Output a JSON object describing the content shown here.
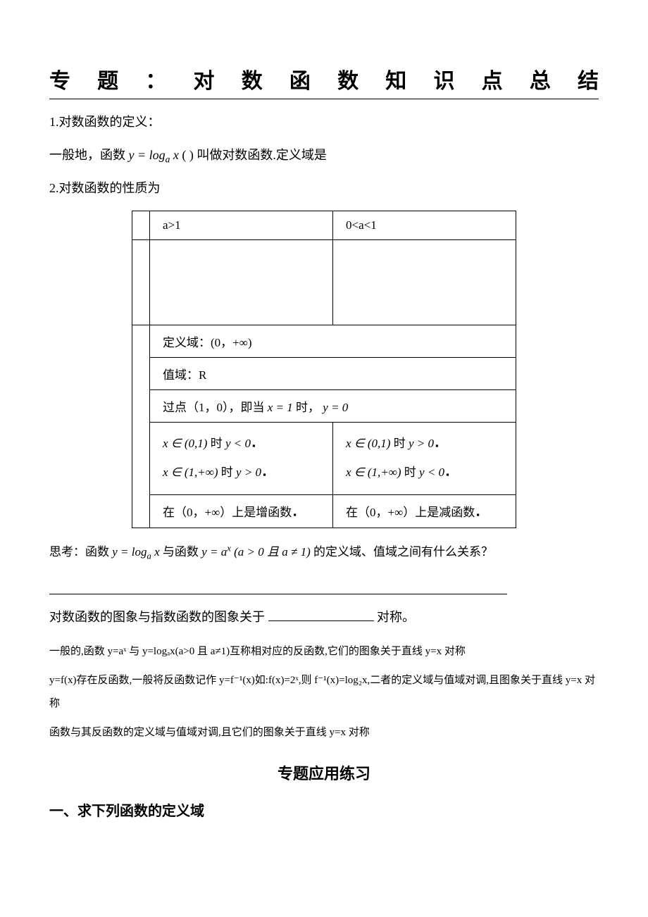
{
  "title": "专题：对数函数知识点总结",
  "p1_lead": "1.对数函数的定义：",
  "p1_body_a": "一般地，函数 ",
  "p1_body_b": " ( ) 叫做对数函数.定义域是",
  "p2_lead": "2.对数函数的性质为",
  "table": {
    "h1": "a>1",
    "h2": "0<a<1",
    "domain": "定义域：(0，+∞)",
    "range": "值域：R",
    "point_a": "过点（1，0），即当 ",
    "point_b": " 时，",
    "l1": " 时 ",
    "r1": " 时 ",
    "l2": " 时 ",
    "r2": " 时 ",
    "inc": "在（0，+∞）上是增函数",
    "dec": "在（0，+∞）上是减函数"
  },
  "think_a": "思考：函数 ",
  "think_b": " 与函数 ",
  "think_c": " 的定义域、值域之间有什么关系？",
  "sym_line_a": "对数函数的图象与指数函数的图象关于",
  "sym_line_b": "对称。",
  "sp1": "一般的,函数 y=aˣ 与 y=logₐx(a>0 且 a≠1)互称相对应的反函数,它们的图象关于直线 y=x 对称",
  "sp2": "y=f(x)存在反函数,一般将反函数记作 y=f⁻¹(x)如:f(x)=2ˣ,则 f⁻¹(x)=log₂x,二者的定义域与值域对调,且图象关于直线 y=x 对称",
  "sp3": "函数与其反函数的定义域与值域对调,且它们的图象关于直线 y=x 对称",
  "subheading": "专题应用练习",
  "section1": "一、求下列函数的定义域",
  "math": {
    "ylogax": "y = logₐ x",
    "x_eq_1": "x = 1",
    "y_eq_0": "y = 0",
    "x01": "x ∈ (0,1)",
    "ylt0": "y < 0",
    "ygt0": "y > 0",
    "x1inf": "x ∈ (1,+∞)",
    "yax": "y = aˣ",
    "cond": "(a > 0 且 a ≠ 1)",
    "dot": "▪"
  }
}
